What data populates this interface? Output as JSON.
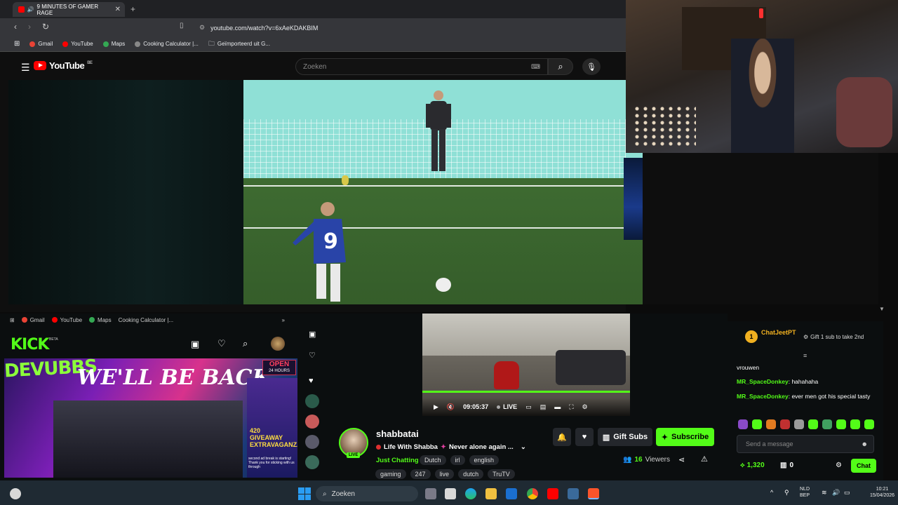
{
  "browser": {
    "tab_title": "9 MINUTES OF GAMER RAGE",
    "tab_close": "✕",
    "new_tab": "+",
    "url": "youtube.com/watch?v=6xAeKDAKBIM",
    "bookmarks": [
      "Gmail",
      "YouTube",
      "Maps",
      "Cooking Calculator |...",
      "Geïmporteerd uit G..."
    ]
  },
  "youtube": {
    "logo_text": "YouTube",
    "country": "BE",
    "search_placeholder": "Zoeken"
  },
  "kick_browser": {
    "bookmarks": [
      "Gmail",
      "YouTube",
      "Maps",
      "Cooking Calculator |..."
    ],
    "logo": "KICK",
    "beta": "BETA"
  },
  "kick": {
    "thumb_title": "DEVUBBS",
    "thumb_banner": "WE'LL BE BACK",
    "thumb_open": "OPEN",
    "thumb_hours": "24 HOURS",
    "thumb_giveaway": "420 GIVEAWAY EXTRAVAGANZA",
    "thumb_note": "second ad break is starting! Thank you for sticking with us through",
    "player": {
      "elapsed": "09:05:37",
      "live_label": "LIVE"
    },
    "streamer": {
      "name": "shabbatai",
      "live_badge": "LIVE",
      "title": "Life With Shabba",
      "title_rest": "Never alone again ...",
      "category": "Just Chatting",
      "tags_row1": [
        "Dutch",
        "irl",
        "english"
      ],
      "tags_row2": [
        "gaming",
        "247",
        "live",
        "dutch",
        "TruTV"
      ],
      "viewers": "16",
      "viewers_label": "Viewers"
    },
    "buttons": {
      "gift_subs": "Gift Subs",
      "subscribe": "Subscribe"
    }
  },
  "chat": {
    "pinned_user": "ChatJeetPT",
    "pinned_count": "1",
    "pinned_gift": "Gift 1 sub to take 2nd",
    "partial_msg": "vrouwen",
    "messages": [
      {
        "user": "MR_SpaceDonkey",
        "text": "hahahaha"
      },
      {
        "user": "MR_SpaceDonkey",
        "text": "ever men got his special tasty"
      }
    ],
    "input_placeholder": "Send a message",
    "points": "1,320",
    "gifts": "0",
    "chat_button": "Chat"
  },
  "taskbar": {
    "search": "Zoeken",
    "lang": "NLD",
    "lang2": "BEP",
    "time": "10:21",
    "date": "15/04/2026"
  },
  "colors": {
    "kick_green": "#53fc18",
    "youtube_red": "#ff0000"
  }
}
